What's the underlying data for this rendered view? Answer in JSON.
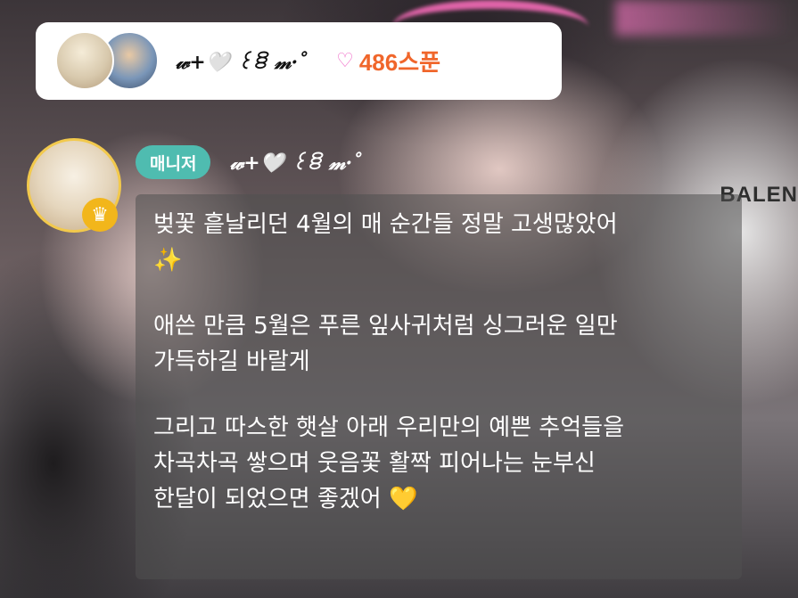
{
  "header": {
    "name": "𝓌+🤍 ꒰ꊞ 𝓂·˚",
    "spoon_icon": "♡",
    "spoon_count": "486스푼"
  },
  "message": {
    "role": "매니저",
    "sender": "𝓌+🤍 ꒰ꊞ 𝓂·˚",
    "lines": [
      "벚꽃 흩날리던 4월의 매 순간들 정말 고생많았어",
      "✨",
      "애쓴 만큼 5월은 푸른 잎사귀처럼 싱그러운 일만",
      "가득하길 바랄게",
      "그리고 따스한 햇살 아래 우리만의 예쁜 추억들을",
      "차곡차곡 쌓으며 웃음꽃 활짝 피어나는 눈부신",
      "한달이 되었으면 좋겠어 💛"
    ]
  },
  "background": {
    "text": "BALEN"
  },
  "colors": {
    "badge": "#4fbcb0",
    "spoon": "#f0662b",
    "crown": "#f2b61b"
  }
}
